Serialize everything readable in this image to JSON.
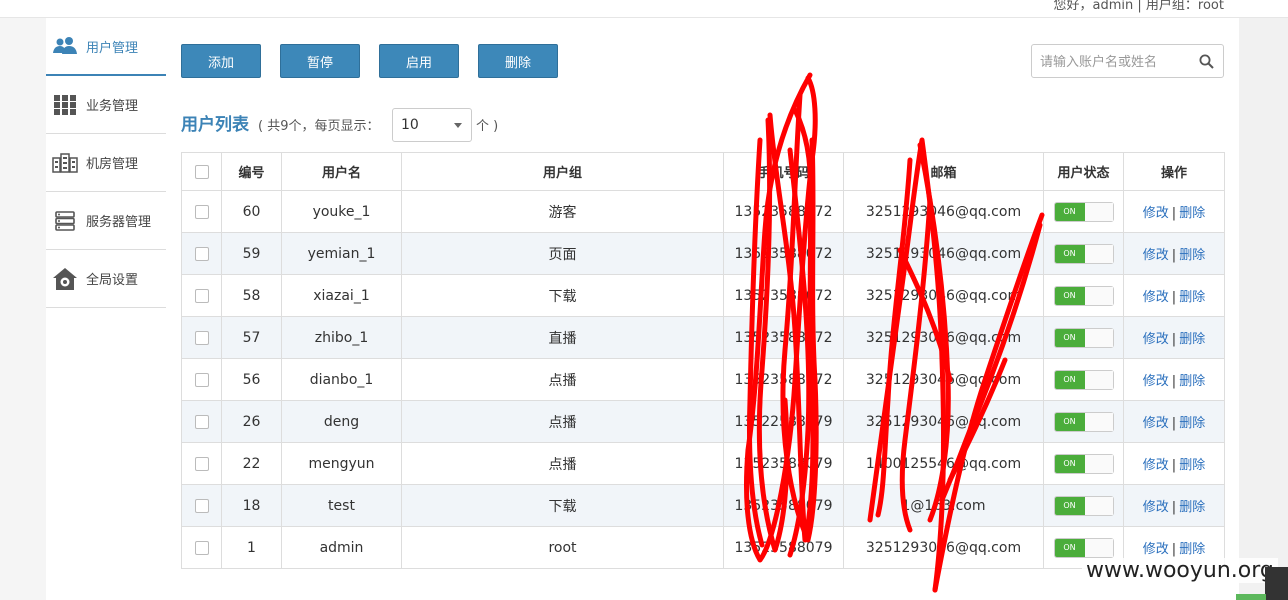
{
  "header": {
    "greeting": "您好，admin  |  用户组：root"
  },
  "sidebar": {
    "items": [
      {
        "label": "用户管理",
        "icon": "users-icon",
        "active": true
      },
      {
        "label": "业务管理",
        "icon": "grid-icon",
        "active": false
      },
      {
        "label": "机房管理",
        "icon": "building-icon",
        "active": false
      },
      {
        "label": "服务器管理",
        "icon": "server-icon",
        "active": false
      },
      {
        "label": "全局设置",
        "icon": "home-gear-icon",
        "active": false
      }
    ]
  },
  "toolbar": {
    "add": "添加",
    "pause": "暂停",
    "enable": "启用",
    "delete": "删除"
  },
  "search": {
    "placeholder": "请输入账户名或姓名",
    "value": ""
  },
  "list": {
    "title": "用户列表",
    "meta": "( 共9个，每页显示：",
    "page_size": "10",
    "unit": "个 )"
  },
  "table": {
    "headers": {
      "id": "编号",
      "username": "用户名",
      "group": "用户组",
      "phone": "手机号码",
      "email": "邮箱",
      "status": "用户状态",
      "ops": "操作"
    },
    "rows": [
      {
        "id": "60",
        "username": "youke_1",
        "group": "游客",
        "phone": "13523588072",
        "email": "3251293046@qq.com",
        "status": "ON"
      },
      {
        "id": "59",
        "username": "yemian_1",
        "group": "页面",
        "phone": "13523588072",
        "email": "3251293046@qq.com",
        "status": "ON"
      },
      {
        "id": "58",
        "username": "xiazai_1",
        "group": "下载",
        "phone": "13523588072",
        "email": "3251293046@qq.com",
        "status": "ON"
      },
      {
        "id": "57",
        "username": "zhibo_1",
        "group": "直播",
        "phone": "13523588072",
        "email": "3251293046@qq.com",
        "status": "ON"
      },
      {
        "id": "56",
        "username": "dianbo_1",
        "group": "点播",
        "phone": "13523588072",
        "email": "3251293046@qq.com",
        "status": "ON"
      },
      {
        "id": "26",
        "username": "deng",
        "group": "点播",
        "phone": "13522588079",
        "email": "3251293046@qq.com",
        "status": "ON"
      },
      {
        "id": "22",
        "username": "mengyun",
        "group": "点播",
        "phone": "13523588079",
        "email": "1400125546@qq.com",
        "status": "ON"
      },
      {
        "id": "18",
        "username": "test",
        "group": "下载",
        "phone": "13523588079",
        "email": "1@163.com",
        "status": "ON"
      },
      {
        "id": "1",
        "username": "admin",
        "group": "root",
        "phone": "13523588079",
        "email": "3251293046@qq.com",
        "status": "ON"
      }
    ],
    "edit_label": "修改",
    "delete_label": "删除",
    "separator": "|"
  },
  "watermark": "www.wooyun.org",
  "colors": {
    "accent": "#3c83b6",
    "button": "#3d88b9",
    "toggle_on": "#4bad3b",
    "link": "#2a6fbd",
    "scribble": "#ff0000"
  }
}
